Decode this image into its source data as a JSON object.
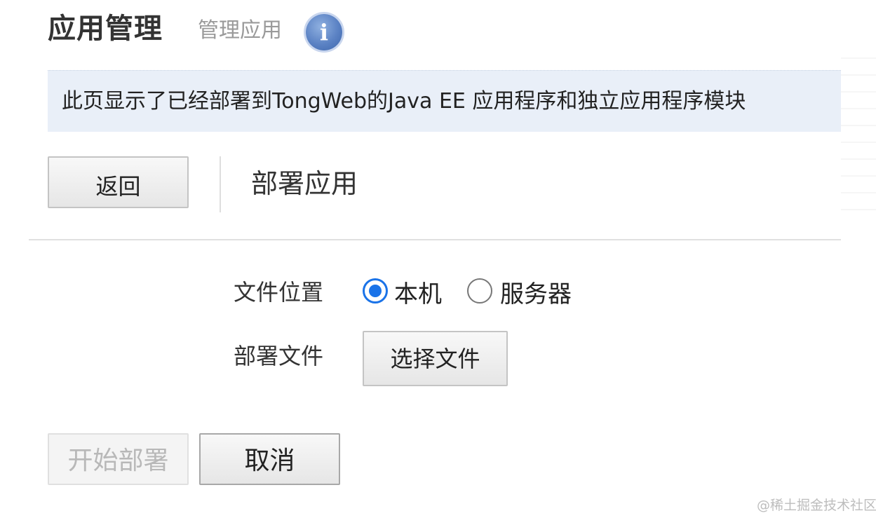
{
  "header": {
    "title": "应用管理",
    "subtitle": "管理应用",
    "info_icon_glyph": "i"
  },
  "banner": {
    "text": "此页显示了已经部署到TongWeb的Java EE 应用程序和独立应用程序模块"
  },
  "toolbar": {
    "back_label": "返回",
    "section_title": "部署应用"
  },
  "form": {
    "file_location_label": "文件位置",
    "location_options": [
      {
        "label": "本机",
        "checked": true
      },
      {
        "label": "服务器",
        "checked": false
      }
    ],
    "deploy_file_label": "部署文件",
    "choose_file_label": "选择文件"
  },
  "actions": {
    "start_deploy_label": "开始部署",
    "cancel_label": "取消"
  },
  "watermark": "@稀土掘金技术社区",
  "colors": {
    "accent": "#1a73e8",
    "banner_bg": "#e9eff8",
    "info_icon": "#5b82c4"
  }
}
